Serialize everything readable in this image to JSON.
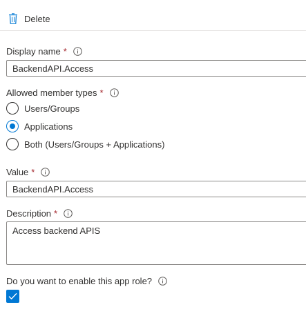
{
  "toolbar": {
    "delete_label": "Delete",
    "delete_icon": "trash-icon"
  },
  "form": {
    "display_name": {
      "label": "Display name",
      "required_mark": "*",
      "value": "BackendAPI.Access",
      "info_icon": "info-icon"
    },
    "allowed_member_types": {
      "label": "Allowed member types",
      "required_mark": "*",
      "options": [
        {
          "label": "Users/Groups",
          "selected": false
        },
        {
          "label": "Applications",
          "selected": true
        },
        {
          "label": "Both (Users/Groups + Applications)",
          "selected": false
        }
      ]
    },
    "value": {
      "label": "Value",
      "required_mark": "*",
      "value": "BackendAPI.Access"
    },
    "description": {
      "label": "Description",
      "required_mark": "*",
      "value": "Access backend APIS"
    },
    "enable_role": {
      "label": "Do you want to enable this app role?",
      "checked": true
    }
  },
  "colors": {
    "accent": "#0078d4",
    "required": "#a4262c",
    "text": "#323130",
    "border": "#8a8886",
    "divider": "#e1dfdd"
  }
}
